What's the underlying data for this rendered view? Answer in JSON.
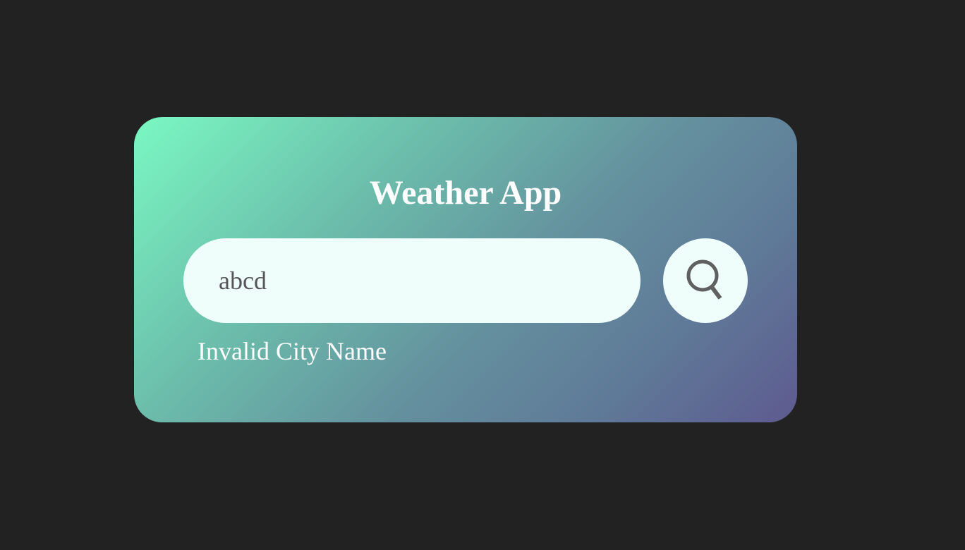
{
  "app": {
    "title": "Weather App"
  },
  "search": {
    "value": "abcd",
    "placeholder": "",
    "button_icon": "search-icon"
  },
  "error": {
    "message": "Invalid City Name"
  },
  "colors": {
    "page_background": "#222222",
    "gradient_start": "#7af8c2",
    "gradient_end": "#5e5a8f",
    "input_background": "#effefb",
    "text_light": "#ffffff",
    "input_text": "#555555"
  }
}
